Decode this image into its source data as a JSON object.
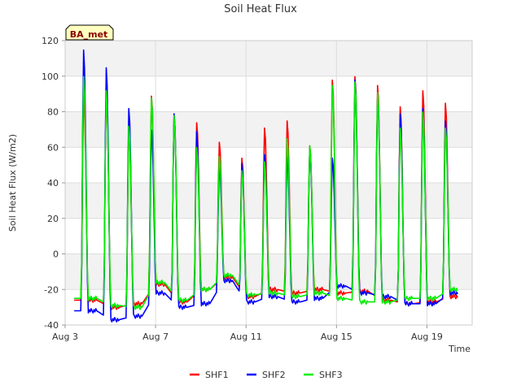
{
  "chart_data": {
    "type": "line",
    "title": "Soil Heat Flux",
    "xlabel": "Time",
    "ylabel": "Soil Heat Flux (W/m2)",
    "badge": "BA_met",
    "ylim": [
      -40,
      120
    ],
    "xlim": [
      3,
      21
    ],
    "yticks": [
      -40,
      -20,
      0,
      20,
      40,
      60,
      80,
      100,
      120
    ],
    "xticks": [
      {
        "value": 3,
        "label": "Aug 3"
      },
      {
        "value": 7,
        "label": "Aug 7"
      },
      {
        "value": 11,
        "label": "Aug 11"
      },
      {
        "value": 15,
        "label": "Aug 15"
      },
      {
        "value": 19,
        "label": "Aug 19"
      }
    ],
    "grid": true,
    "legend": "bottom",
    "series": [
      {
        "name": "SHF1",
        "color": "#ff0000",
        "peaks": [
          90,
          93,
          70,
          89,
          78,
          74,
          63,
          54,
          71,
          75,
          61,
          98,
          100,
          95,
          83,
          92,
          85
        ],
        "troughs": [
          -26,
          -30,
          -28,
          -17,
          -27,
          -20,
          -13,
          -24,
          -20,
          -22,
          -20,
          -22,
          -21,
          -26,
          -28,
          -27,
          -24
        ]
      },
      {
        "name": "SHF2",
        "color": "#0000ff",
        "peaks": [
          115,
          105,
          82,
          70,
          79,
          69,
          49,
          51,
          56,
          55,
          60,
          54,
          98,
          89,
          79,
          82,
          75
        ],
        "troughs": [
          -32,
          -37,
          -35,
          -22,
          -30,
          -28,
          -15,
          -27,
          -24,
          -27,
          -25,
          -18,
          -22,
          -24,
          -28,
          -28,
          -22
        ]
      },
      {
        "name": "SHF3",
        "color": "#00ee00",
        "peaks": [
          100,
          92,
          72,
          88,
          78,
          60,
          55,
          47,
          52,
          65,
          61,
          95,
          97,
          91,
          71,
          80,
          71
        ],
        "troughs": [
          -25,
          -29,
          -30,
          -16,
          -26,
          -20,
          -12,
          -23,
          -22,
          -24,
          -22,
          -25,
          -27,
          -27,
          -25,
          -25,
          -20
        ]
      }
    ]
  }
}
